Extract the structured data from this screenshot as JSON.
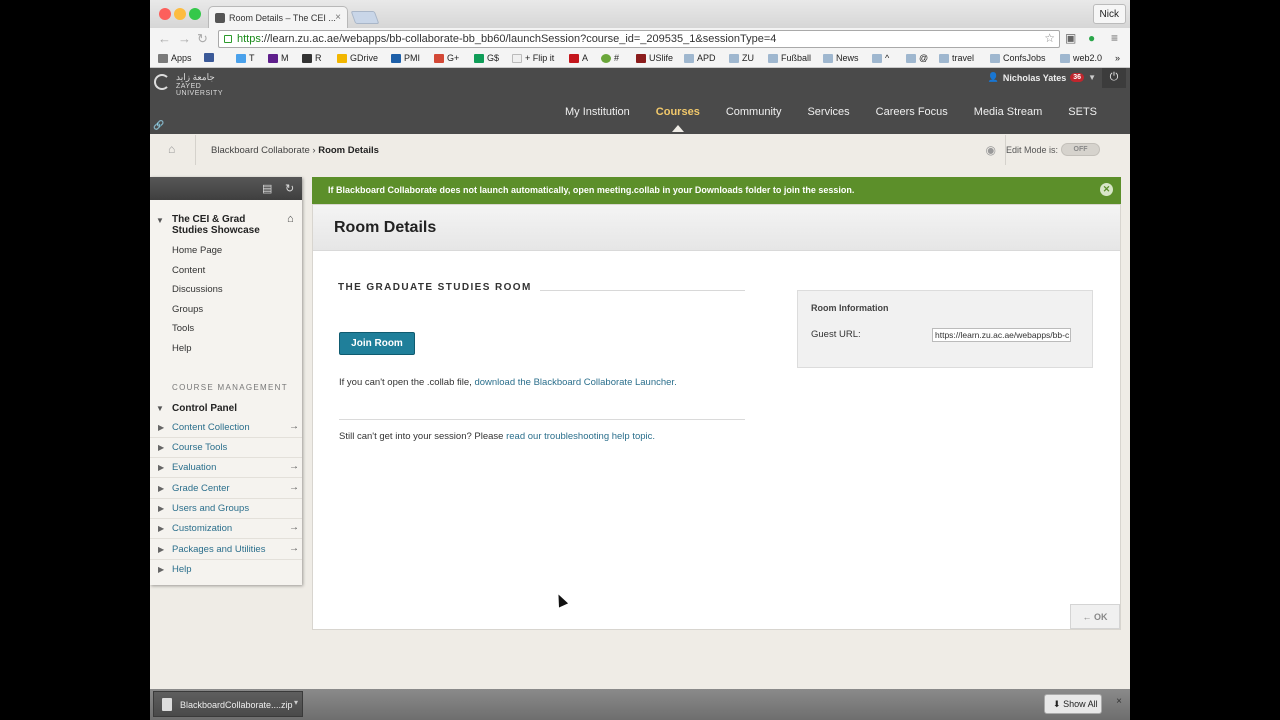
{
  "browser": {
    "tab_title": "Room Details – The CEI ...",
    "tab_close": "×",
    "profile": "Nick",
    "url_scheme": "https",
    "url_rest": "://learn.zu.ac.ae/webapps/bb-collaborate-bb_bb60/launchSession?course_id=_209535_1&sessionType=4",
    "bookmarks": [
      "Apps",
      "",
      "T",
      "M",
      "R",
      "GDrive",
      "PMI",
      "G+",
      "G$",
      "+ Flip it",
      "A",
      "#",
      "USlife",
      "APD",
      "ZU",
      "Fußball",
      "News",
      "^",
      "@",
      "travel",
      "ConfsJobs",
      "web2.0",
      "»"
    ]
  },
  "header": {
    "logo_arabic": "جامعة زايد",
    "logo_english": "ZAYED UNIVERSITY",
    "user_name": "Nicholas Yates",
    "notification_count": "36",
    "nav": [
      {
        "label": "My Institution"
      },
      {
        "label": "Courses"
      },
      {
        "label": "Community"
      },
      {
        "label": "Services"
      },
      {
        "label": "Careers Focus"
      },
      {
        "label": "Media Stream"
      },
      {
        "label": "SETS"
      }
    ],
    "active_nav": "Courses"
  },
  "breadcrumb": {
    "parent": "Blackboard Collaborate",
    "separator": "›",
    "current": "Room Details",
    "edit_mode_label": "Edit Mode is:",
    "edit_mode_value": "OFF"
  },
  "menu": {
    "course_title": "The CEI & Grad Studies Showcase",
    "items": [
      "Home Page",
      "Content",
      "Discussions",
      "Groups",
      "Tools",
      "Help"
    ],
    "management_label": "COURSE MANAGEMENT",
    "control_panel": "Control Panel",
    "control_items": [
      {
        "label": "Content Collection",
        "arrow": "→"
      },
      {
        "label": "Course Tools",
        "arrow": ""
      },
      {
        "label": "Evaluation",
        "arrow": "→"
      },
      {
        "label": "Grade Center",
        "arrow": "→"
      },
      {
        "label": "Users and Groups",
        "arrow": ""
      },
      {
        "label": "Customization",
        "arrow": "→"
      },
      {
        "label": "Packages and Utilities",
        "arrow": "→"
      },
      {
        "label": "Help",
        "arrow": ""
      }
    ]
  },
  "notice": {
    "text": "If Blackboard Collaborate does not launch automatically, open meeting.collab in your Downloads folder to join the session."
  },
  "content": {
    "title": "Room Details",
    "room_heading": "THE GRADUATE STUDIES ROOM",
    "join_button": "Join Room",
    "collab_text": "If you can't open the .collab file, ",
    "collab_link": "download the Blackboard Collaborate Launcher.",
    "trouble_text": "Still can't get into your session? Please ",
    "trouble_link": "read our troubleshooting help topic.",
    "info_heading": "Room Information",
    "guest_url_label": "Guest URL:",
    "guest_url_value": "https://learn.zu.ac.ae/webapps/bb-c",
    "ok_button": "← OK"
  },
  "downloads": {
    "file_name": "BlackboardCollaborate....zip",
    "show_all": "Show All",
    "close": "×"
  },
  "colors": {
    "notice_green": "#5c8f2a",
    "join_button": "#1f7f9a",
    "active_nav": "#f2c96b",
    "link": "#2b6f8c"
  }
}
